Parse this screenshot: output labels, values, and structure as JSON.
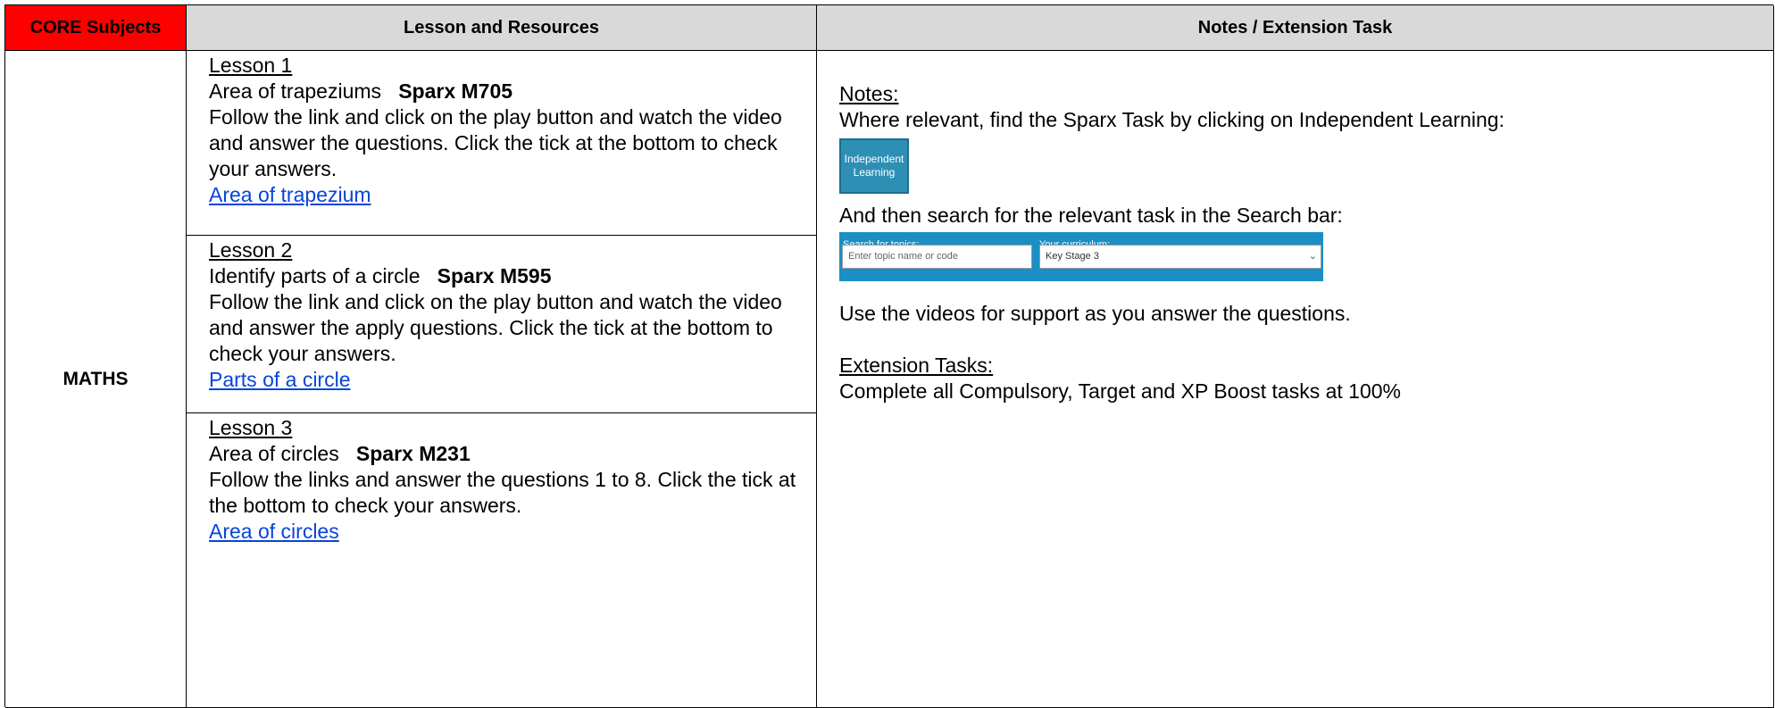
{
  "header": {
    "col1": "CORE Subjects",
    "col2": "Lesson and Resources",
    "col3": "Notes / Extension Task"
  },
  "subject": "MATHS",
  "lessons": [
    {
      "title": "Lesson 1",
      "topic": "Area of trapeziums",
      "code": "Sparx M705",
      "instructions": "Follow the link and click on the play button and watch the video and answer the questions. Click the tick at the bottom to check your answers.",
      "link": "Area of trapezium"
    },
    {
      "title": "Lesson 2",
      "topic": "Identify parts of a circle",
      "code": "Sparx M595",
      "instructions": "Follow the link and click on the play button and watch the video and answer the apply questions. Click the tick at the bottom to check your answers.",
      "link": "Parts of a circle"
    },
    {
      "title": "Lesson 3",
      "topic": "Area of circles",
      "code": "Sparx M231",
      "instructions": "Follow the links and answer the questions 1 to 8. Click the tick at the bottom to check your answers.",
      "link": "Area of circles"
    }
  ],
  "notes": {
    "heading": "Notes:",
    "text1": "Where relevant, find the Sparx Task by clicking on Independent Learning:",
    "il_button": "Independent Learning",
    "text2": "And then search for the relevant task in the Search bar:",
    "search_label": "Search for topics:",
    "curriculum_label": "Your curriculum:",
    "search_placeholder": "Enter topic name or code",
    "curriculum_value": "Key Stage 3",
    "text3": "Use the videos for support as you answer the questions.",
    "ext_heading": "Extension Tasks:",
    "ext_text": "Complete all Compulsory, Target and XP Boost tasks at 100%"
  },
  "colors": {
    "core_header": "#ff0000",
    "header_bg": "#d9d9d9",
    "link": "#0645d8",
    "sparx_blue": "#1b8fc4"
  }
}
